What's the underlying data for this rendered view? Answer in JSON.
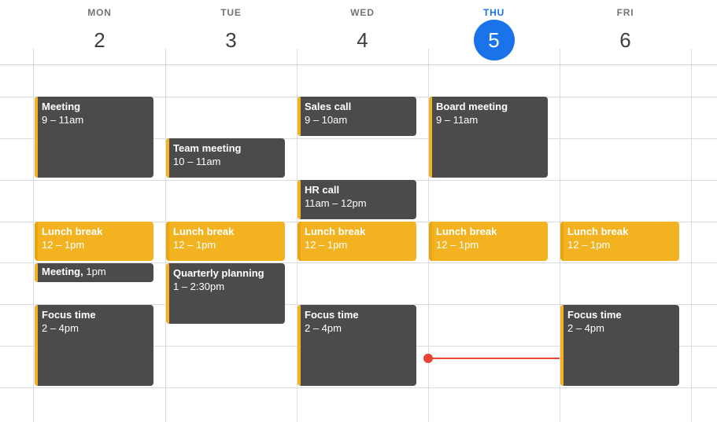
{
  "days": [
    {
      "dow": "MON",
      "date": "2",
      "today": false
    },
    {
      "dow": "TUE",
      "date": "3",
      "today": false
    },
    {
      "dow": "WED",
      "date": "4",
      "today": false
    },
    {
      "dow": "THU",
      "date": "5",
      "today": true
    },
    {
      "dow": "FRI",
      "date": "6",
      "today": false
    }
  ],
  "events": [
    {
      "day": 0,
      "title": "Meeting",
      "time": "9 – 11am",
      "start": 9,
      "end": 11,
      "style": "dark"
    },
    {
      "day": 0,
      "title": "Lunch break",
      "time": "12 – 1pm",
      "start": 12,
      "end": 13,
      "style": "yellow"
    },
    {
      "day": 0,
      "title": "Meeting,",
      "time": "1pm",
      "start": 13,
      "end": 13.5,
      "style": "dark",
      "compact": true
    },
    {
      "day": 0,
      "title": "Focus time",
      "time": "2 – 4pm",
      "start": 14,
      "end": 16,
      "style": "dark"
    },
    {
      "day": 1,
      "title": "Team meeting",
      "time": "10 – 11am",
      "start": 10,
      "end": 11,
      "style": "dark"
    },
    {
      "day": 1,
      "title": "Lunch break",
      "time": "12 – 1pm",
      "start": 12,
      "end": 13,
      "style": "yellow"
    },
    {
      "day": 1,
      "title": "Quarterly planning",
      "time": "1 – 2:30pm",
      "start": 13,
      "end": 14.5,
      "style": "dark"
    },
    {
      "day": 2,
      "title": "Sales call",
      "time": "9 – 10am",
      "start": 9,
      "end": 10,
      "style": "dark"
    },
    {
      "day": 2,
      "title": "HR call",
      "time": "11am – 12pm",
      "start": 11,
      "end": 12,
      "style": "dark"
    },
    {
      "day": 2,
      "title": "Lunch break",
      "time": "12 – 1pm",
      "start": 12,
      "end": 13,
      "style": "yellow"
    },
    {
      "day": 2,
      "title": "Focus time",
      "time": "2 – 4pm",
      "start": 14,
      "end": 16,
      "style": "dark"
    },
    {
      "day": 3,
      "title": "Board meeting",
      "time": "9 – 11am",
      "start": 9,
      "end": 11,
      "style": "dark"
    },
    {
      "day": 3,
      "title": "Lunch break",
      "time": "12 – 1pm",
      "start": 12,
      "end": 13,
      "style": "yellow"
    },
    {
      "day": 4,
      "title": "Lunch break",
      "time": "12 – 1pm",
      "start": 12,
      "end": 13,
      "style": "yellow"
    },
    {
      "day": 4,
      "title": "Focus time",
      "time": "2 – 4pm",
      "start": 14,
      "end": 16,
      "style": "dark"
    }
  ],
  "current_time": {
    "day": 3,
    "hour": 15.5
  },
  "colors": {
    "today_accent": "#1a73e8",
    "event_dark": "#4b4b4b",
    "event_yellow": "#f3b320",
    "now_indicator": "#ea4335",
    "grid": "#dadce0"
  }
}
